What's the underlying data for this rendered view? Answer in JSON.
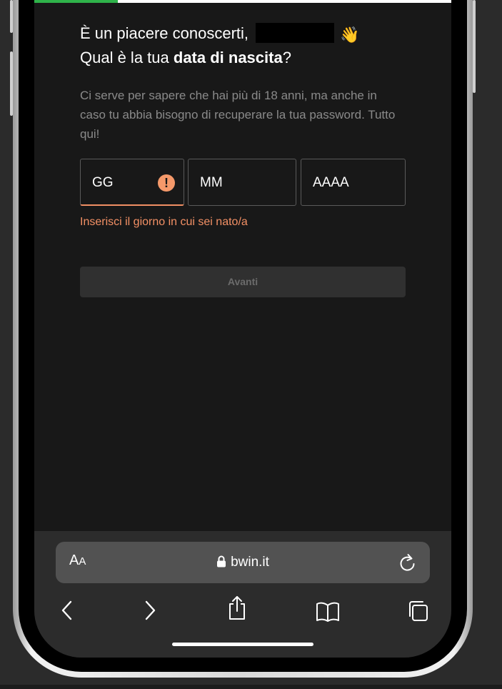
{
  "progress": {
    "fraction": 0.2
  },
  "heading": {
    "greeting": "È un piacere conoscerti,",
    "wave_emoji": "👋",
    "question_prefix": "Qual è la tua ",
    "question_bold": "data di nascita",
    "question_suffix": "?"
  },
  "subtitle": "Ci serve per sapere che hai più di 18 anni, ma anche in caso tu abbia bisogno di recuperare la tua password. Tutto qui!",
  "date_fields": {
    "day": {
      "placeholder": "GG",
      "error_icon": "!"
    },
    "month": {
      "placeholder": "MM"
    },
    "year": {
      "placeholder": "AAAA"
    }
  },
  "error_message": "Inserisci il giorno in cui sei nato/a",
  "next_button": {
    "label": "Avanti"
  },
  "browser": {
    "text_size_label": "A",
    "text_size_label_small": "A",
    "url": "bwin.it"
  },
  "colors": {
    "accent_progress": "#2fb34a",
    "error": "#f39065",
    "background": "#181818"
  }
}
